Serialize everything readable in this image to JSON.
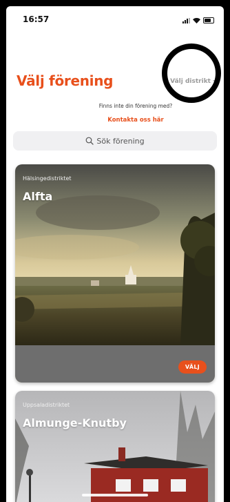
{
  "status_bar": {
    "time": "16:57"
  },
  "header": {
    "title": "Välj förening",
    "district_select_label": "Välj distrikt",
    "missing_text": "Finns inte din förening med?",
    "contact_link": "Kontakta oss här"
  },
  "search": {
    "placeholder": "Sök förening"
  },
  "associations": [
    {
      "district": "Hälsingedistriktet",
      "name": "Alfta",
      "select_label": "VÄLJ"
    },
    {
      "district": "Uppsaladistriktet",
      "name": "Almunge-Knutby"
    }
  ],
  "colors": {
    "accent": "#e8501c",
    "search_bg": "#f0f0f2",
    "card_footer": "#6e6e6e"
  }
}
